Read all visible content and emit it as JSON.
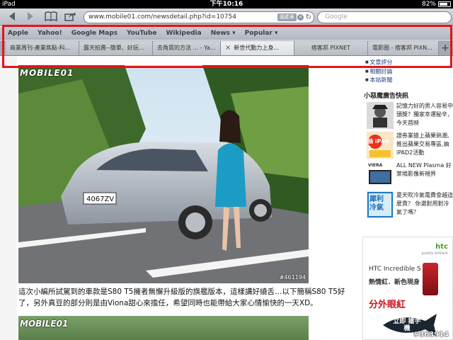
{
  "status_bar": {
    "device": "iPad",
    "time": "下午10:16",
    "battery": "82%",
    "battery_level": 0.82
  },
  "toolbar": {
    "url": "www.mobile01.com/newsdetail.php?id=10754",
    "title_badge": "國產車",
    "search_placeholder": "Google",
    "icons": [
      "back-arrow-icon",
      "forward-arrow-icon",
      "bookmarks-book-icon",
      "share-icon",
      "reload-icon",
      "clear-icon"
    ]
  },
  "bookmarks": [
    "Apple",
    "Yahoo!",
    "Google Maps",
    "YouTube",
    "Wikipedia",
    "News ▾",
    "Popular ▾"
  ],
  "tabs": [
    {
      "label": "商業周刊-產業焦點-科..."
    },
    {
      "label": "露天拍賣--簡單、好玩..."
    },
    {
      "label": "去角質的方法 ... - Ya..."
    },
    {
      "label": "新世代動力上身...",
      "active": true
    },
    {
      "label": "痞客邦 PIXNET"
    },
    {
      "label": "電影圈 - 痞客邦 PIXN..."
    }
  ],
  "article": {
    "watermark": "MOBILE01",
    "photo_id": "#461194",
    "text": "這次小編所試駕到的車款是S80 T5擁者無懈升級版的旗艦版本，這樣講好繞舌…以下簡稱S80 T5好了，另外真豆的部分則是由Viona甜心來擔任，希望同時也能帶給大家心情愉快的一天XD。"
  },
  "sidebar": {
    "links": [
      "文章評分",
      "相關討論",
      "本站新聞"
    ],
    "ad_title": "小惡魔廣告快訊",
    "ads": [
      {
        "text": "記憶力好的男人容易中頭獎？獨家幸運秘辛，今天首映"
      },
      {
        "text": "證券業搶上蘋果熱潮,推出蘋果交易專區,抽iPAD2活動"
      },
      {
        "text": "ALL NEW Plasma 好萊塢影像新視界"
      },
      {
        "text": "夏天吹冷氣電費會越這麼貴？ 你選對用對冷氣了嗎？"
      }
    ],
    "ad_thumb_labels": [
      "",
      "抽 iPad 2",
      "VIERA",
      "犀利 冷氣"
    ],
    "banner": {
      "brand": "htc",
      "slogan": "quietly brilliant",
      "model": "HTC Incredible S",
      "line2": "熱情紅．新色現身",
      "line3": "分外眼紅",
      "cta": "立即 搶手機"
    }
  },
  "footer_id": "#363914",
  "colors": {
    "highlight": "#e8111b",
    "link": "#1a3b7a",
    "toolbar_top": "#d6d9df"
  }
}
